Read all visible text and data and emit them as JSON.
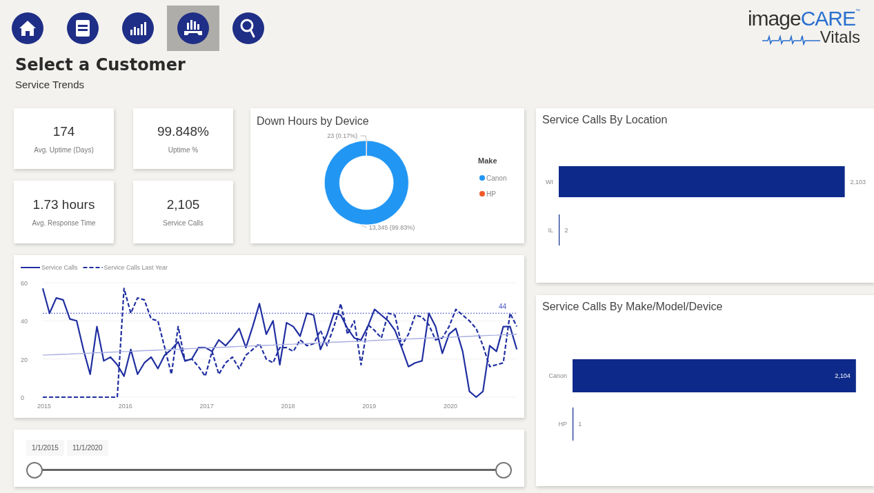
{
  "nav": [
    {
      "selected": false
    },
    {
      "selected": false
    },
    {
      "selected": false
    },
    {
      "selected": true
    },
    {
      "selected": false
    }
  ],
  "logo": {
    "word_1": "image",
    "word_2": "CARE",
    "word_3": "Vitals",
    "mark": "™"
  },
  "title": "Select a Customer",
  "subtitle": "Service Trends",
  "kpis": [
    {
      "value": "174",
      "label": "Avg. Uptime (Days)"
    },
    {
      "value": "99.848%",
      "label": "Uptime %"
    },
    {
      "value": "1.73 hours",
      "label": "Avg. Response Time"
    },
    {
      "value": "2,105",
      "label": "Service Calls"
    }
  ],
  "donut": {
    "chart_data": {
      "type": "donut",
      "title": "Down Hours by Device",
      "categories": [
        "Canon",
        "HP"
      ],
      "values": [
        13345,
        23
      ],
      "colors": [
        "#2196f3",
        "#f05a28"
      ],
      "value_labels": [
        "13,345 (99.83%)",
        "23 (0.17%)"
      ],
      "legend": {
        "title": "Make"
      }
    }
  },
  "trend": {
    "chart_data": {
      "type": "line",
      "legend": true,
      "x": [
        "2015-01",
        "2015-02",
        "2015-03",
        "2015-04",
        "2015-05",
        "2015-06",
        "2015-07",
        "2015-08",
        "2015-09",
        "2015-10",
        "2015-11",
        "2015-12",
        "2016-01",
        "2016-02",
        "2016-03",
        "2016-04",
        "2016-05",
        "2016-06",
        "2016-07",
        "2016-08",
        "2016-09",
        "2016-10",
        "2016-11",
        "2016-12",
        "2017-01",
        "2017-02",
        "2017-03",
        "2017-04",
        "2017-05",
        "2017-06",
        "2017-07",
        "2017-08",
        "2017-09",
        "2017-10",
        "2017-11",
        "2017-12",
        "2018-01",
        "2018-02",
        "2018-03",
        "2018-04",
        "2018-05",
        "2018-06",
        "2018-07",
        "2018-08",
        "2018-09",
        "2018-10",
        "2018-11",
        "2018-12",
        "2019-01",
        "2019-02",
        "2019-03",
        "2019-04",
        "2019-05",
        "2019-06",
        "2019-07",
        "2019-08",
        "2019-09",
        "2019-10",
        "2019-11",
        "2019-12",
        "2020-01",
        "2020-02",
        "2020-03",
        "2020-04",
        "2020-05",
        "2020-06",
        "2020-07",
        "2020-08",
        "2020-09",
        "2020-10",
        "2020-11"
      ],
      "series": [
        {
          "name": "Service Calls",
          "color": "#1f2ea0",
          "line_style": "solid",
          "values": [
            57,
            44,
            52,
            51,
            41,
            40,
            25,
            12,
            37,
            19,
            21,
            17,
            11,
            25,
            12,
            18,
            21,
            15,
            22,
            25,
            29,
            19,
            20,
            26,
            26,
            24,
            30,
            27,
            31,
            36,
            26,
            37,
            49,
            33,
            40,
            17,
            39,
            37,
            32,
            44,
            43,
            25,
            33,
            44,
            43,
            36,
            31,
            30,
            37,
            46,
            43,
            40,
            35,
            26,
            16,
            18,
            19,
            44,
            37,
            23,
            33,
            36,
            24,
            3,
            0,
            3,
            27,
            24,
            37,
            37,
            25
          ]
        },
        {
          "name": "Service Calls Last Year",
          "color": "#1f2ea0",
          "line_style": "dashed",
          "values": [
            0,
            0,
            0,
            0,
            0,
            0,
            0,
            0,
            0,
            0,
            0,
            0,
            57,
            44,
            52,
            51,
            41,
            40,
            26,
            12,
            37,
            19,
            20,
            16,
            11,
            24,
            12,
            18,
            21,
            15,
            22,
            25,
            28,
            20,
            18,
            26,
            26,
            24,
            30,
            27,
            28,
            35,
            27,
            37,
            49,
            33,
            40,
            17,
            38,
            35,
            31,
            44,
            43,
            27,
            33,
            43,
            42,
            38,
            30,
            31,
            37,
            46,
            43,
            40,
            36,
            27,
            16,
            17,
            18,
            44,
            37
          ]
        },
        {
          "color": "#a8aee0",
          "line_style": "solid",
          "values": [
            22.0,
            22.2,
            22.3,
            22.5,
            22.6,
            22.8,
            22.9,
            23.1,
            23.3,
            23.4,
            23.6,
            23.7,
            23.9,
            24.0,
            24.2,
            24.4,
            24.5,
            24.7,
            24.8,
            25.0,
            25.1,
            25.3,
            25.5,
            25.6,
            25.8,
            25.9,
            26.1,
            26.2,
            26.4,
            26.6,
            26.7,
            26.9,
            27.0,
            27.2,
            27.3,
            27.5,
            27.7,
            27.8,
            28.0,
            28.1,
            28.3,
            28.4,
            28.6,
            28.8,
            28.9,
            29.1,
            29.2,
            29.4,
            29.5,
            29.7,
            29.9,
            30.0,
            30.2,
            30.3,
            30.5,
            30.6,
            30.8,
            31.0,
            31.1,
            31.3,
            31.4,
            31.6,
            31.7,
            31.9,
            32.1,
            32.2,
            32.4,
            32.5,
            32.7,
            32.8,
            33.0
          ]
        }
      ],
      "xlim": [
        "2015-01",
        "2020-11"
      ],
      "ylim": [
        0,
        60
      ],
      "yticks": [
        0,
        20,
        40,
        60
      ],
      "xticks": [
        {
          "value": "2015-01",
          "label": "2015"
        },
        {
          "value": "2016-01",
          "label": "2016"
        },
        {
          "value": "2017-01",
          "label": "2017"
        },
        {
          "value": "2018-01",
          "label": "2018"
        },
        {
          "value": "2019-01",
          "label": "2019"
        },
        {
          "value": "2020-01",
          "label": "2020"
        }
      ],
      "ref_lines": [
        {
          "axis": "y",
          "value": 44,
          "label": "44"
        }
      ]
    }
  },
  "date_range": {
    "start": "1/1/2015",
    "end": "11/1/2020",
    "thumbs": [
      {
        "level": 0
      },
      {
        "level": 1
      }
    ]
  },
  "location": {
    "chart_data": {
      "type": "bar",
      "orientation": "horizontal",
      "title": "Service Calls By Location",
      "categories": [
        "WI",
        "IL"
      ],
      "values": [
        2103,
        2
      ],
      "value_labels": [
        "2,103",
        "2"
      ]
    }
  },
  "make_model": {
    "chart_data": {
      "type": "bar",
      "orientation": "horizontal",
      "title": "Service Calls By Make/Model/Device",
      "categories": [
        "Canon",
        "HP"
      ],
      "values": [
        2104,
        1
      ],
      "value_labels": [
        "2,104",
        "1"
      ]
    }
  }
}
